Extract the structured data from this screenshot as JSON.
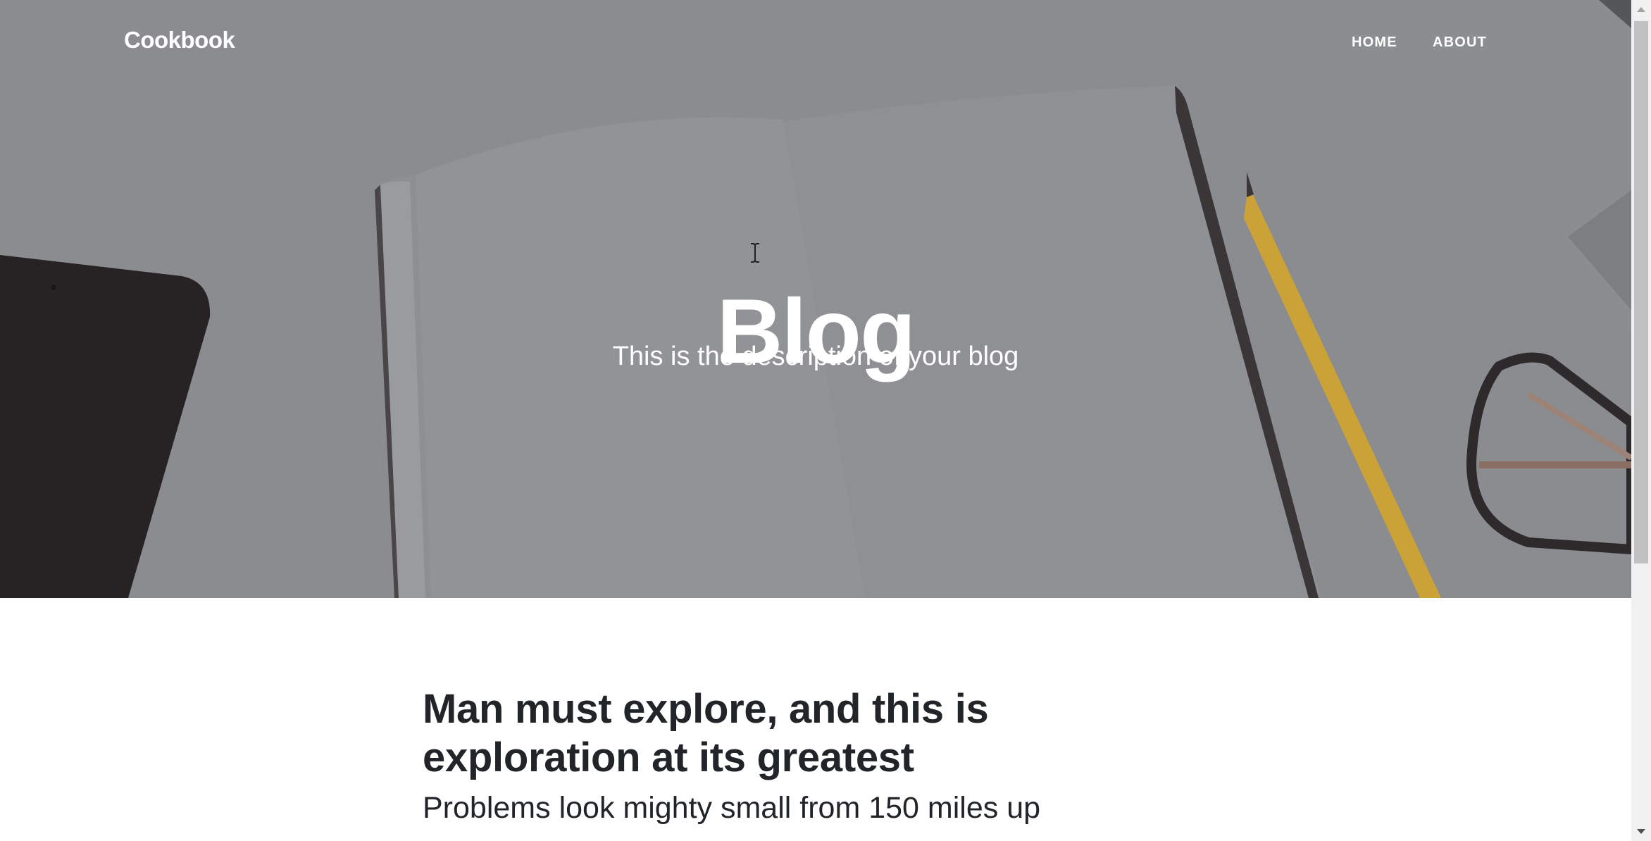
{
  "navbar": {
    "brand": "Cookbook",
    "links": [
      "HOME",
      "ABOUT"
    ]
  },
  "hero": {
    "title": "Blog",
    "subtitle": "This is the description of your blog"
  },
  "post": {
    "title": "Man must explore, and this is exploration at its greatest",
    "subtitle": "Problems look mighty small from 150 miles up"
  },
  "colors": {
    "hero_overlay": "#8a8b8f",
    "text_dark": "#212529",
    "text_light": "#ffffff"
  },
  "icons": [
    "text-cursor-icon",
    "scroll-up-arrow-icon",
    "scroll-down-arrow-icon"
  ]
}
